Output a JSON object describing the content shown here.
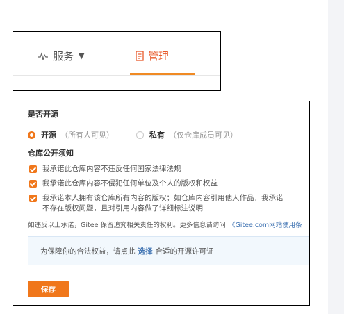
{
  "tabs": {
    "service_label": "服务",
    "manage_label": "管理",
    "accent_color": "#e8592a"
  },
  "visibility": {
    "title": "是否开源",
    "options": [
      {
        "label": "开源",
        "hint": "（所有人可见）",
        "selected": true
      },
      {
        "label": "私有",
        "hint": "（仅仓库成员可见）",
        "selected": false
      }
    ]
  },
  "notice": {
    "title": "仓库公开须知",
    "items": [
      {
        "text": "我承诺此仓库内容不违反任何国家法律法规",
        "checked": true
      },
      {
        "text": "我承诺此仓库内容不侵犯任何单位及个人的版权和权益",
        "checked": true
      },
      {
        "text": "我承诺本人拥有该仓库所有内容的版权；如仓库内容引用他人作品，我承诺",
        "text_line2": "不存在版权问题，且对引用内容做了详细标注说明",
        "checked": true
      }
    ],
    "footnote": "如违反以上承诺，Gitee 保留追究相关责任的权利。更多信息请访问",
    "footnote_link": "《Gitee.com网站使用条"
  },
  "license": {
    "prefix": "为保障你的合法权益，请点此",
    "link": "选择",
    "suffix": "合适的开源许可证"
  },
  "save_label": "保存",
  "icons": {
    "service": "pulse-icon",
    "manage": "document-list-icon",
    "caret": "caret-down-icon"
  },
  "colors": {
    "primary": "#f0771b",
    "link": "#3a6fb0",
    "info_bg": "#f2f8fd"
  }
}
